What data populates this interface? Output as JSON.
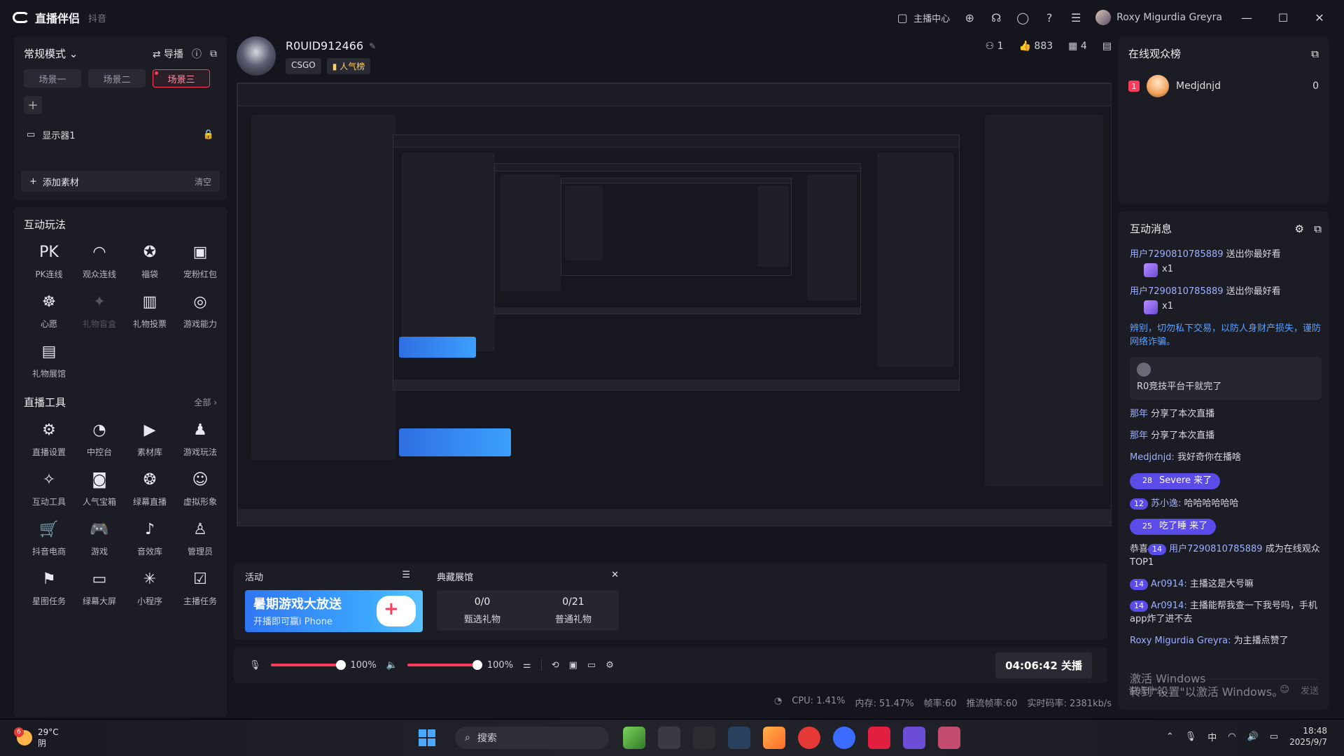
{
  "window": {
    "app_title": "直播伴侣",
    "platform": "抖音",
    "anchor_center": "主播中心",
    "user_name": "Roxy Migurdia Greyra"
  },
  "left": {
    "mode": "常规模式",
    "guide": "导播",
    "scenes": [
      "场景一",
      "场景二",
      "场景三"
    ],
    "source": "显示器1",
    "add_source": "添加素材",
    "clear": "清空",
    "interactive_title": "互动玩法",
    "interactive_tools": [
      {
        "label": "PK连线",
        "icon": "pk-icon",
        "glyph": "PK",
        "disabled": false
      },
      {
        "label": "观众连线",
        "icon": "audience-link-icon",
        "glyph": "◠",
        "disabled": false
      },
      {
        "label": "福袋",
        "icon": "lucky-bag-icon",
        "glyph": "✪",
        "disabled": false
      },
      {
        "label": "宠粉红包",
        "icon": "red-packet-icon",
        "glyph": "▣",
        "disabled": false
      },
      {
        "label": "心愿",
        "icon": "wish-icon",
        "glyph": "☸",
        "disabled": false
      },
      {
        "label": "礼物盲盒",
        "icon": "blind-box-icon",
        "glyph": "✦",
        "disabled": true
      },
      {
        "label": "礼物投票",
        "icon": "gift-vote-icon",
        "glyph": "▥",
        "disabled": false
      },
      {
        "label": "游戏能力",
        "icon": "game-ability-icon",
        "glyph": "◎",
        "disabled": false
      },
      {
        "label": "礼物展馆",
        "icon": "gift-gallery-icon",
        "glyph": "▤",
        "disabled": false
      }
    ],
    "live_tools_title": "直播工具",
    "live_tools_more": "全部 ›",
    "live_tools": [
      {
        "label": "直播设置",
        "icon": "live-settings-icon",
        "glyph": "⚙"
      },
      {
        "label": "中控台",
        "icon": "console-icon",
        "glyph": "◔"
      },
      {
        "label": "素材库",
        "icon": "material-library-icon",
        "glyph": "▶"
      },
      {
        "label": "游戏玩法",
        "icon": "game-play-icon",
        "glyph": "♟"
      },
      {
        "label": "互动工具",
        "icon": "interactive-tools-icon",
        "glyph": "✧"
      },
      {
        "label": "人气宝箱",
        "icon": "popularity-chest-icon",
        "glyph": "◙"
      },
      {
        "label": "绿幕直播",
        "icon": "green-screen-icon",
        "glyph": "❂"
      },
      {
        "label": "虚拟形象",
        "icon": "avatar-icon",
        "glyph": "☺"
      },
      {
        "label": "抖音电商",
        "icon": "ecommerce-icon",
        "glyph": "🛒"
      },
      {
        "label": "游戏",
        "icon": "game-icon",
        "glyph": "🎮"
      },
      {
        "label": "音效库",
        "icon": "sound-effects-icon",
        "glyph": "♪"
      },
      {
        "label": "管理员",
        "icon": "admin-icon",
        "glyph": "♙"
      },
      {
        "label": "星图任务",
        "icon": "star-task-icon",
        "glyph": "⚑"
      },
      {
        "label": "绿幕大屏",
        "icon": "big-screen-icon",
        "glyph": "▭"
      },
      {
        "label": "小程序",
        "icon": "mini-program-icon",
        "glyph": "✳"
      },
      {
        "label": "主播任务",
        "icon": "anchor-task-icon",
        "glyph": "☑"
      }
    ]
  },
  "room": {
    "id": "R0UID912466",
    "tag_game": "CSGO",
    "tag_popular": "人气榜",
    "viewers": "1",
    "likes": "883",
    "gifts": "4"
  },
  "activity": {
    "title": "活动",
    "banner_title": "暑期游戏大放送",
    "banner_sub": "开播即可赢i Phone",
    "gallery_title": "典藏展馆",
    "gallery_stats": [
      {
        "value": "0/0",
        "label": "甄选礼物"
      },
      {
        "value": "0/21",
        "label": "普通礼物"
      }
    ]
  },
  "controls": {
    "mic_volume": "100%",
    "speaker_volume": "100%",
    "mic_level": 1.0,
    "speaker_level": 1.0,
    "live_time_button": "04:06:42 关播"
  },
  "perf": {
    "cpu": "CPU: 1.41%",
    "memory": "内存: 51.47%",
    "fps": "帧率:60",
    "push_fps": "推流帧率:60",
    "bitrate": "实时码率: 2381kb/s"
  },
  "right": {
    "viewers_title": "在线观众榜",
    "top_viewer": {
      "rank": "1",
      "name": "Medjdnjd",
      "score": "0"
    },
    "messages_title": "互动消息",
    "messages": [
      {
        "type": "gift",
        "user": "用户7290810785889",
        "text": "送出你最好看",
        "count": "x1"
      },
      {
        "type": "gift",
        "user": "用户7290810785889",
        "text": "送出你最好看",
        "count": "x1"
      },
      {
        "type": "warn",
        "text": "辨别，切勿私下交易，以防人身财产损失，谨防网络诈骗。"
      },
      {
        "type": "quote",
        "text": "R0竞技平台干就完了"
      },
      {
        "type": "text",
        "user": "那年",
        "text": "分享了本次直播"
      },
      {
        "type": "text",
        "user": "那年",
        "text": "分享了本次直播"
      },
      {
        "type": "text",
        "user": "Medjdnjd:",
        "text": "我好奇你在播啥"
      },
      {
        "type": "pill",
        "level": "28",
        "text": "Severe 来了"
      },
      {
        "type": "text",
        "level": "12",
        "user": "苏小逸:",
        "text": "哈哈哈哈哈哈"
      },
      {
        "type": "pill",
        "level": "25",
        "text": "吃了睡 来了"
      },
      {
        "type": "top",
        "prefix": "恭喜",
        "level": "14",
        "user": "用户7290810785889",
        "text": "成为在线观众TOP1"
      },
      {
        "type": "text",
        "level": "14",
        "user": "Ar0914:",
        "text": "主播这是大号嘛"
      },
      {
        "type": "text",
        "level": "14",
        "user": "Ar0914:",
        "text": "主播能帮我查一下我号吗，手机app炸了进不去"
      },
      {
        "type": "text",
        "user": "Roxy Migurdia Greyra:",
        "text": "为主播点赞了"
      }
    ],
    "input_placeholder": "说点什么...",
    "send": "发送"
  },
  "watermark": {
    "line1": "激活 Windows",
    "line2": "转到\"设置\"以激活 Windows。"
  },
  "taskbar": {
    "temperature": "29°C",
    "weather": "阴",
    "weather_badge": "6",
    "search": "搜索",
    "time": "18:48",
    "date": "2025/9/7",
    "ime": "中"
  }
}
